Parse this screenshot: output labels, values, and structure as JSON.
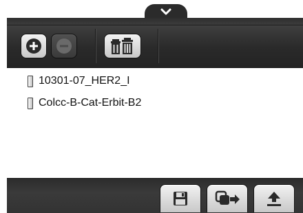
{
  "toolbar": {
    "buttons": [
      {
        "name": "add-button",
        "icon": "plus-circle-icon",
        "enabled": true
      },
      {
        "name": "remove-button",
        "icon": "minus-circle-icon",
        "enabled": false
      },
      {
        "name": "delete-all-button",
        "icon": "trash-cans-icon",
        "enabled": true
      }
    ]
  },
  "list": {
    "items": [
      {
        "label": "10301-07_HER2_I"
      },
      {
        "label": "Colcc-B-Cat-Erbit-B2"
      }
    ]
  },
  "bottombar": {
    "buttons": [
      {
        "name": "save-button",
        "icon": "floppy-disk-icon"
      },
      {
        "name": "copy-export-button",
        "icon": "copy-arrow-icon"
      },
      {
        "name": "upload-button",
        "icon": "upload-arrow-icon"
      }
    ]
  },
  "colors": {
    "toolbar": "#2a2a2a",
    "button_face": "#dcdcdc",
    "text": "#111111",
    "icon_dark": "#2a2a2a"
  }
}
